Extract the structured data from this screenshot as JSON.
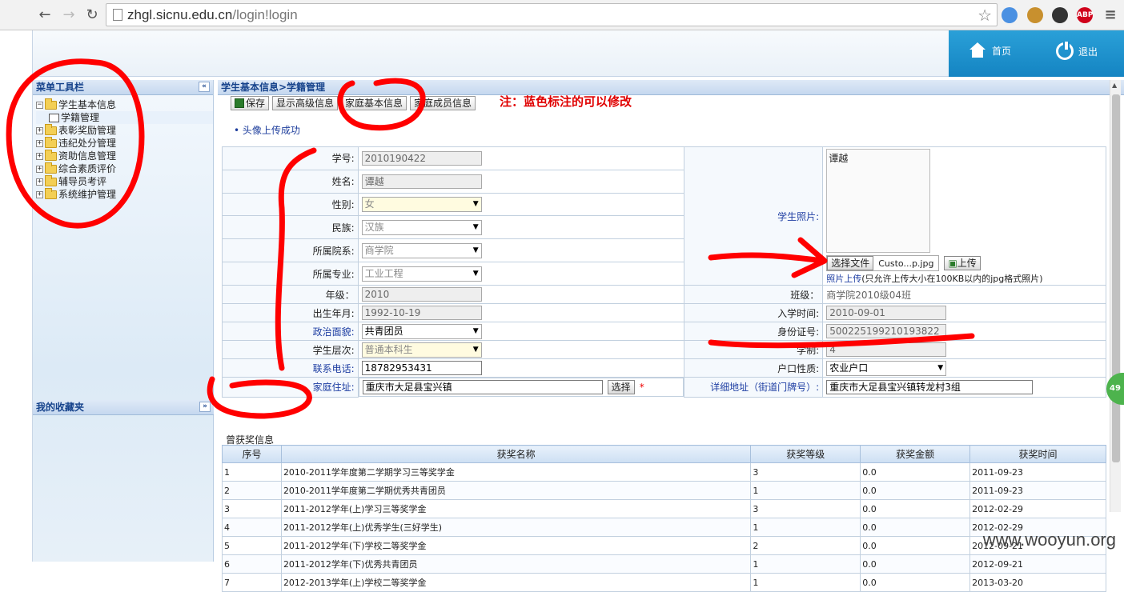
{
  "browser": {
    "url_host": "zhgl.sicnu.edu.cn",
    "url_path": "/login!login",
    "extensions": [
      {
        "name": "chrome-sync-icon",
        "color": "#4a90e2",
        "label": ""
      },
      {
        "name": "cookie-icon",
        "color": "#c8902e",
        "label": ""
      },
      {
        "name": "spy-icon",
        "color": "#333333",
        "label": ""
      },
      {
        "name": "adblock-icon",
        "color": "#d0021b",
        "label": "ABP"
      },
      {
        "name": "menu-icon",
        "color": "#555555",
        "label": "≡"
      }
    ]
  },
  "topnav": {
    "home": "首页",
    "logout": "退出"
  },
  "sidebar": {
    "title": "菜单工具栏",
    "items": [
      {
        "label": "学生基本信息",
        "expanded": true
      },
      {
        "label": "学籍管理",
        "child": true
      },
      {
        "label": "表彰奖励管理"
      },
      {
        "label": "违纪处分管理"
      },
      {
        "label": "资助信息管理"
      },
      {
        "label": "综合素质评价"
      },
      {
        "label": "辅导员考评"
      },
      {
        "label": "系统维护管理"
      }
    ],
    "favorites_title": "我的收藏夹"
  },
  "main": {
    "breadcrumb": "学生基本信息>学籍管理",
    "toolbar": {
      "save": "保存",
      "advanced": "显示高级信息",
      "family": "家庭基本信息",
      "members": "家庭成员信息"
    },
    "note": "注：蓝色标注的可以修改",
    "message": "头像上传成功",
    "fields": {
      "student_id_label": "学号:",
      "student_id": "2010190422",
      "name_label": "姓名:",
      "name": "谭越",
      "gender_label": "性别:",
      "gender": "女",
      "ethnicity_label": "民族:",
      "ethnicity": "汉族",
      "college_label": "所属院系:",
      "college": "商学院",
      "major_label": "所属专业:",
      "major": "工业工程",
      "grade_label": "年级：",
      "grade": "2010",
      "class_label": "班级：",
      "class": "商学院2010级04班",
      "birth_label": "出生年月:",
      "birth": "1992-10-19",
      "enroll_label": "入学时间:",
      "enroll": "2010-09-01",
      "politics_label": "政治面貌:",
      "politics": "共青团员",
      "idcard_label": "身份证号:",
      "idcard": "500225199210193822",
      "level_label": "学生层次:",
      "level": "普通本科生",
      "years_label": "学制:",
      "years": "4",
      "phone_label": "联系电话:",
      "phone": "18782953431",
      "hukou_label": "户口性质:",
      "hukou": "农业户口",
      "address_label": "家庭住址:",
      "address": "重庆市大足县宝兴镇",
      "choose_btn": "选择",
      "required": "*",
      "detail_label": "详细地址（街道门牌号）:",
      "detail": "重庆市大足县宝兴镇转龙村3组",
      "photo_label": "学生照片:",
      "photo_alt": "谭越",
      "file_btn": "选择文件",
      "file_name": "Custo...p.jpg",
      "upload_btn": "上传",
      "upload_link": "照片上传",
      "upload_hint": "(只允许上传大小在100KB以内的jpg格式照片)"
    },
    "awards_title": "曾获奖信息",
    "awards_headers": [
      "序号",
      "获奖名称",
      "获奖等级",
      "获奖金额",
      "获奖时间"
    ],
    "awards_rows": [
      [
        "1",
        "2010-2011学年度第二学期学习三等奖学金",
        "3",
        "0.0",
        "2011-09-23"
      ],
      [
        "2",
        "2010-2011学年度第二学期优秀共青团员",
        "1",
        "0.0",
        "2011-09-23"
      ],
      [
        "3",
        "2011-2012学年(上)学习三等奖学金",
        "3",
        "0.0",
        "2012-02-29"
      ],
      [
        "4",
        "2011-2012学年(上)优秀学生(三好学生)",
        "1",
        "0.0",
        "2012-02-29"
      ],
      [
        "5",
        "2011-2012学年(下)学校二等奖学金",
        "2",
        "0.0",
        "2012-09-21"
      ],
      [
        "6",
        "2011-2012学年(下)优秀共青团员",
        "1",
        "0.0",
        "2012-09-21"
      ],
      [
        "7",
        "2012-2013学年(上)学校二等奖学金",
        "1",
        "0.0",
        "2013-03-20"
      ]
    ]
  },
  "badge": "49",
  "watermark": "www.wooyun.org"
}
